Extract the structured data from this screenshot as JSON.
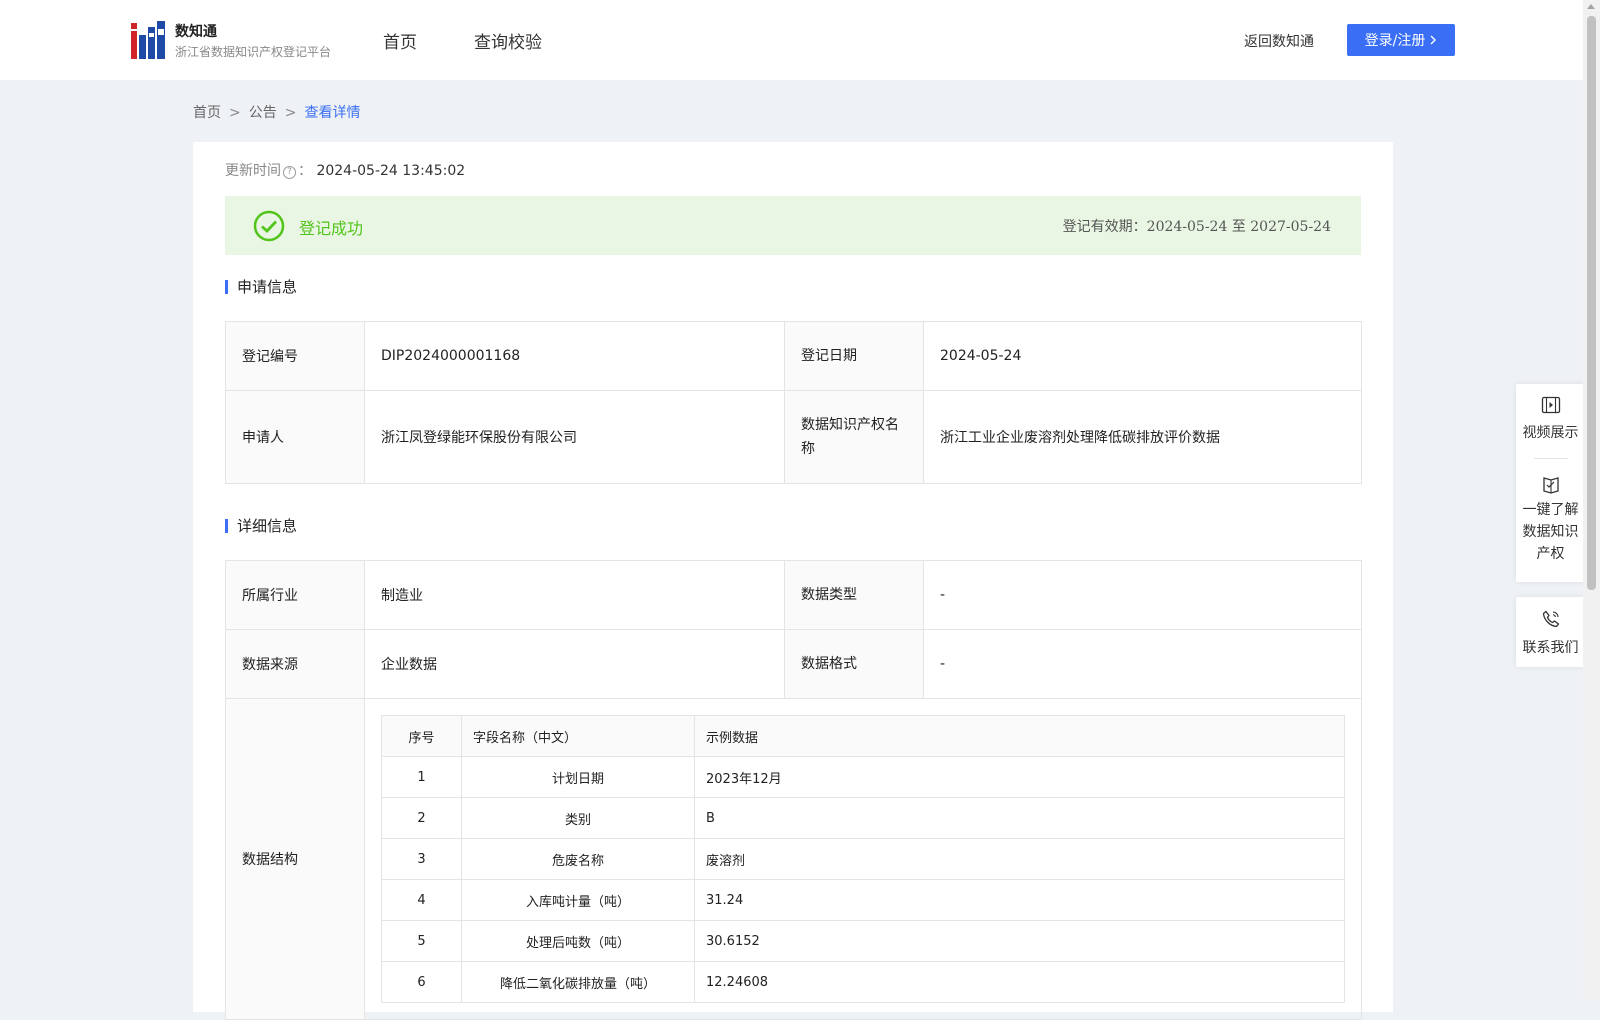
{
  "header": {
    "brand_name": "数知通",
    "brand_sub": "浙江省数据知识产权登记平台",
    "nav": [
      "首页",
      "查询校验"
    ],
    "back_link": "返回数知通",
    "login_label": "登录/注册",
    "accent": "#3a6ff5"
  },
  "breadcrumb": [
    "首页",
    "公告",
    "查看详情"
  ],
  "update": {
    "label": "更新时间",
    "value": "2024-05-24 13:45:02"
  },
  "status": {
    "text": "登记成功",
    "validity_label": "登记有效期：",
    "validity_value": "2024-05-24 至 2027-05-24",
    "color": "#52c41a"
  },
  "application": {
    "title": "申请信息",
    "reg_no_label": "登记编号",
    "reg_no": "DIP2024000001168",
    "reg_date_label": "登记日期",
    "reg_date": "2024-05-24",
    "applicant_label": "申请人",
    "applicant": "浙江凤登绿能环保股份有限公司",
    "ip_name_label": "数据知识产权名称",
    "ip_name": "浙江工业企业废溶剂处理降低碳排放评价数据"
  },
  "detail": {
    "title": "详细信息",
    "industry_label": "所属行业",
    "industry": "制造业",
    "data_type_label": "数据类型",
    "data_type": "-",
    "source_label": "数据来源",
    "source": "企业数据",
    "format_label": "数据格式",
    "format": "-",
    "structure_label": "数据结构",
    "structure_headers": [
      "序号",
      "字段名称（中文）",
      "示例数据"
    ],
    "structure_rows": [
      [
        "1",
        "计划日期",
        "2023年12月"
      ],
      [
        "2",
        "类别",
        "B"
      ],
      [
        "3",
        "危废名称",
        "废溶剂"
      ],
      [
        "4",
        "入库吨计量（吨）",
        "31.24"
      ],
      [
        "5",
        "处理后吨数（吨）",
        "30.6152"
      ],
      [
        "6",
        "降低二氧化碳排放量（吨）",
        "12.24608"
      ]
    ]
  },
  "side": {
    "video": "视频展示",
    "learn": [
      "一键了解",
      "数据知识",
      "产权"
    ],
    "contact": "联系我们"
  }
}
